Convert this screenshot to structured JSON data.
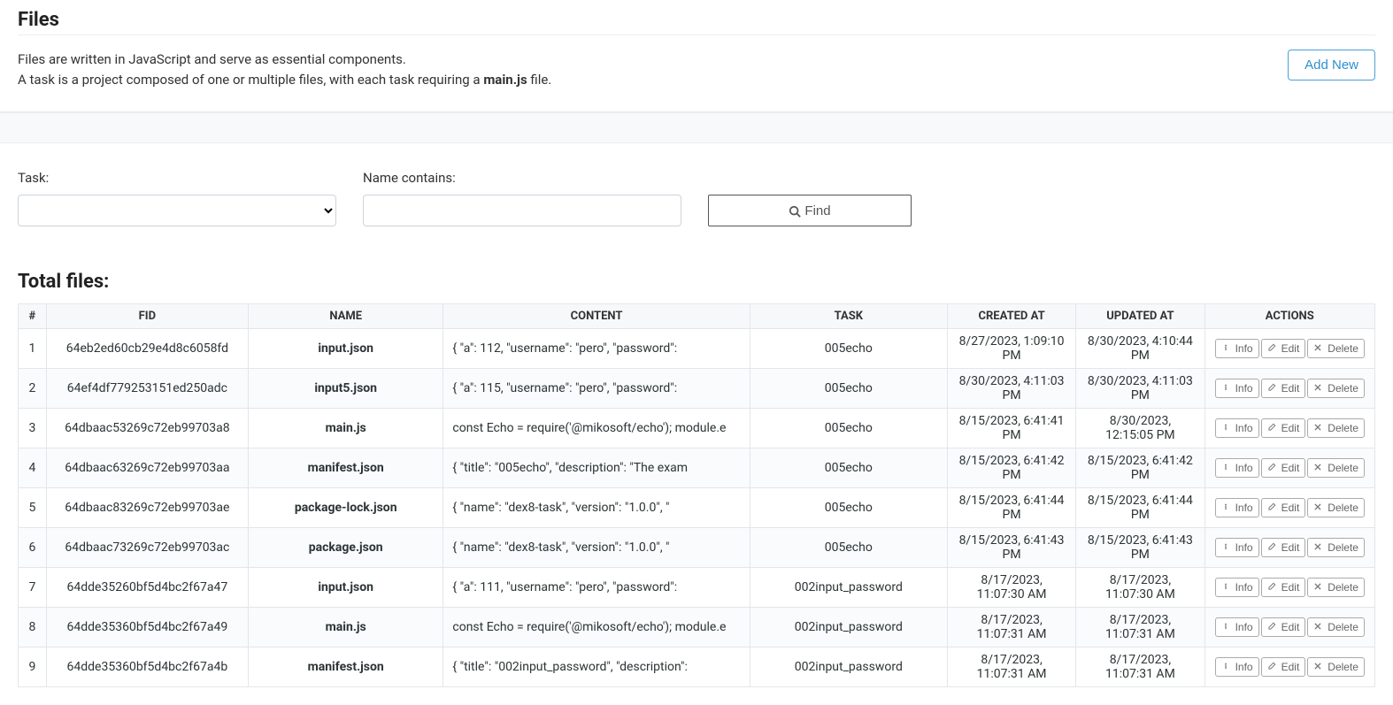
{
  "header": {
    "title": "Files",
    "desc_line1": "Files are written in JavaScript and serve as essential components.",
    "desc_line2_before": "A task is a project composed of one or multiple files, with each task requiring a ",
    "desc_line2_bold": "main.js",
    "desc_line2_after": " file.",
    "add_button": "Add New"
  },
  "filters": {
    "task_label": "Task:",
    "name_label": "Name contains:",
    "find_label": "Find"
  },
  "total_label": "Total files:",
  "columns": {
    "idx": "#",
    "fid": "FID",
    "name": "NAME",
    "content": "CONTENT",
    "task": "TASK",
    "created": "CREATED AT",
    "updated": "UPDATED AT",
    "actions": "ACTIONS"
  },
  "action_labels": {
    "info": "Info",
    "edit": "Edit",
    "delete": "Delete"
  },
  "rows": [
    {
      "idx": "1",
      "fid": "64eb2ed60cb29e4d8c6058fd",
      "name": "input.json",
      "content": "{ \"a\": 112, \"username\": \"pero\", \"password\":",
      "task": "005echo",
      "created": "8/27/2023, 1:09:10 PM",
      "updated": "8/30/2023, 4:10:44 PM"
    },
    {
      "idx": "2",
      "fid": "64ef4df779253151ed250adc",
      "name": "input5.json",
      "content": "{ \"a\": 115, \"username\": \"pero\", \"password\":",
      "task": "005echo",
      "created": "8/30/2023, 4:11:03 PM",
      "updated": "8/30/2023, 4:11:03 PM"
    },
    {
      "idx": "3",
      "fid": "64dbaac53269c72eb99703a8",
      "name": "main.js",
      "content": "const Echo = require('@mikosoft/echo'); module.e",
      "task": "005echo",
      "created": "8/15/2023, 6:41:41 PM",
      "updated": "8/30/2023, 12:15:05 PM"
    },
    {
      "idx": "4",
      "fid": "64dbaac63269c72eb99703aa",
      "name": "manifest.json",
      "content": "{ \"title\": \"005echo\", \"description\": \"The exam",
      "task": "005echo",
      "created": "8/15/2023, 6:41:42 PM",
      "updated": "8/15/2023, 6:41:42 PM"
    },
    {
      "idx": "5",
      "fid": "64dbaac83269c72eb99703ae",
      "name": "package-lock.json",
      "content": "{ \"name\": \"dex8-task\", \"version\": \"1.0.0\", \"",
      "task": "005echo",
      "created": "8/15/2023, 6:41:44 PM",
      "updated": "8/15/2023, 6:41:44 PM"
    },
    {
      "idx": "6",
      "fid": "64dbaac73269c72eb99703ac",
      "name": "package.json",
      "content": "{ \"name\": \"dex8-task\", \"version\": \"1.0.0\", \"",
      "task": "005echo",
      "created": "8/15/2023, 6:41:43 PM",
      "updated": "8/15/2023, 6:41:43 PM"
    },
    {
      "idx": "7",
      "fid": "64dde35260bf5d4bc2f67a47",
      "name": "input.json",
      "content": "{ \"a\": 111, \"username\": \"pero\", \"password\":",
      "task": "002input_password",
      "created": "8/17/2023, 11:07:30 AM",
      "updated": "8/17/2023, 11:07:30 AM"
    },
    {
      "idx": "8",
      "fid": "64dde35360bf5d4bc2f67a49",
      "name": "main.js",
      "content": "const Echo = require('@mikosoft/echo'); module.e",
      "task": "002input_password",
      "created": "8/17/2023, 11:07:31 AM",
      "updated": "8/17/2023, 11:07:31 AM"
    },
    {
      "idx": "9",
      "fid": "64dde35360bf5d4bc2f67a4b",
      "name": "manifest.json",
      "content": "{ \"title\": \"002input_password\", \"description\":",
      "task": "002input_password",
      "created": "8/17/2023, 11:07:31 AM",
      "updated": "8/17/2023, 11:07:31 AM"
    }
  ]
}
